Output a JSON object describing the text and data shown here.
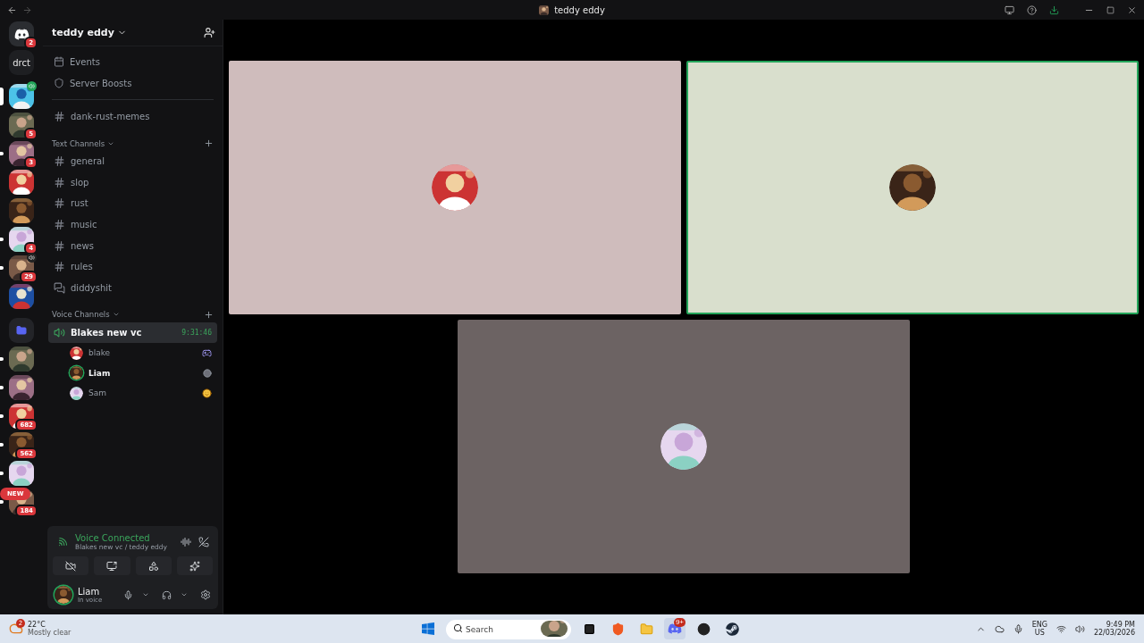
{
  "window": {
    "title": "teddy eddy"
  },
  "servers": [
    {
      "kind": "logo",
      "badge": "2",
      "selected": false,
      "unread": false,
      "voice": false
    },
    {
      "kind": "text",
      "label": "drct",
      "selected": false,
      "unread": false,
      "voice": false
    },
    {
      "kind": "picture",
      "selected": true,
      "unread": false,
      "voice": true
    },
    {
      "kind": "picture",
      "badge": "5",
      "selected": false,
      "unread": false,
      "voice": false
    },
    {
      "kind": "picture",
      "badge": "3",
      "selected": false,
      "unread": true,
      "voice": false
    },
    {
      "kind": "picture",
      "selected": false,
      "unread": false,
      "voice": false
    },
    {
      "kind": "picture",
      "selected": false,
      "unread": false,
      "voice": false
    },
    {
      "kind": "picture",
      "badge": "4",
      "selected": false,
      "unread": true,
      "voice": false
    },
    {
      "kind": "picture",
      "badge": "29",
      "selected": false,
      "unread": true,
      "voice": true
    },
    {
      "kind": "picture",
      "selected": false,
      "unread": false,
      "voice": false
    },
    {
      "kind": "folder",
      "selected": false,
      "unread": false,
      "voice": false
    },
    {
      "kind": "picture",
      "selected": false,
      "unread": true,
      "voice": false
    },
    {
      "kind": "picture",
      "selected": false,
      "unread": true,
      "voice": false
    },
    {
      "kind": "picture",
      "badge": "682",
      "selected": false,
      "unread": true,
      "voice": false
    },
    {
      "kind": "picture",
      "badge": "562",
      "selected": false,
      "unread": true,
      "voice": false
    },
    {
      "kind": "picture",
      "selected": false,
      "unread": true,
      "voice": false
    },
    {
      "kind": "picture",
      "badge": "184",
      "tag": "NEW",
      "selected": false,
      "unread": true,
      "voice": false
    }
  ],
  "server": {
    "name": "teddy eddy"
  },
  "shortcuts": [
    {
      "kind": "events",
      "label": "Events"
    },
    {
      "kind": "boosts",
      "label": "Server Boosts"
    }
  ],
  "pinned_channels": [
    {
      "name": "dank-rust-memes"
    }
  ],
  "text_channels": {
    "title": "Text Channels",
    "items": [
      {
        "name": "general",
        "kind": "text"
      },
      {
        "name": "slop",
        "kind": "text"
      },
      {
        "name": "rust",
        "kind": "text"
      },
      {
        "name": "music",
        "kind": "text"
      },
      {
        "name": "news",
        "kind": "text"
      },
      {
        "name": "rules",
        "kind": "text"
      },
      {
        "name": "diddyshit",
        "kind": "thread"
      }
    ]
  },
  "voice_channels": {
    "title": "Voice Channels",
    "items": [
      {
        "name": "Blakes new vc",
        "timer": "9:31:46",
        "selected": true,
        "members": [
          {
            "name": "blake",
            "speaking": false,
            "kind": "game"
          },
          {
            "name": "Liam",
            "speaking": true,
            "kind": "status"
          },
          {
            "name": "Sam",
            "speaking": false,
            "kind": "emoji"
          }
        ]
      }
    ]
  },
  "voice_panel": {
    "status": "Voice Connected",
    "location": "Blakes new vc / teddy eddy"
  },
  "user": {
    "name": "Liam",
    "status": "In voice"
  },
  "tiles": [
    {
      "color": "#cfbcbc",
      "speaking": false
    },
    {
      "color": "#d9dfcd",
      "speaking": true
    },
    {
      "color": "#6c6363",
      "speaking": false
    }
  ],
  "taskbar": {
    "weather": {
      "temp": "22°C",
      "summary": "Mostly clear",
      "badge": "2"
    },
    "search": {
      "placeholder": "Search"
    },
    "discord_badge": "9+",
    "language": "ENG",
    "region": "US",
    "time": "9:49 PM",
    "date": "22/03/2026"
  }
}
